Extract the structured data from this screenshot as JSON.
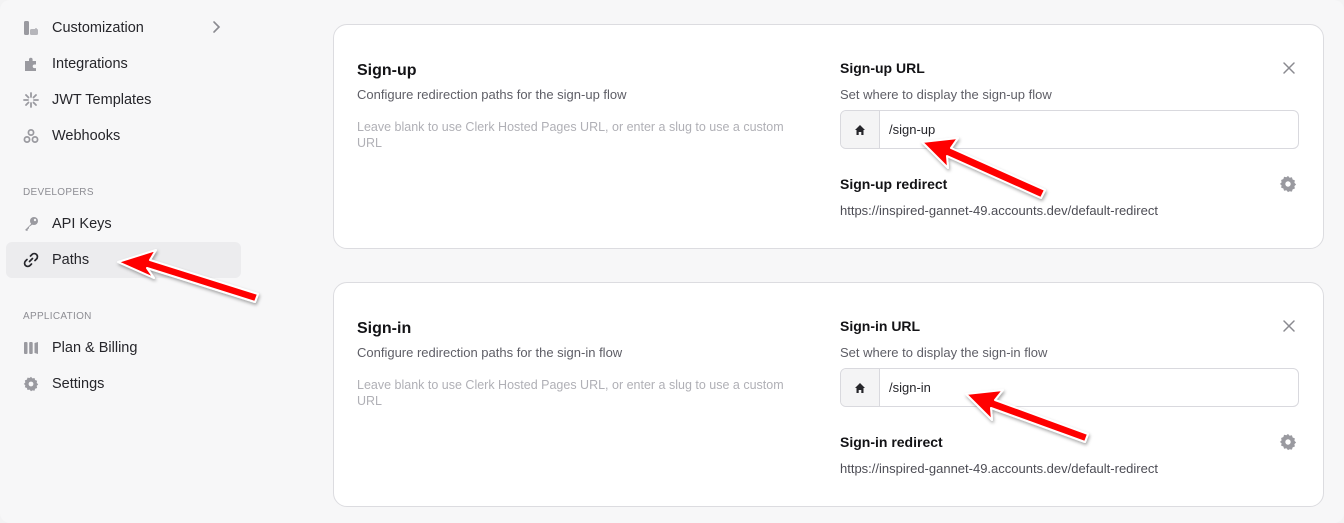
{
  "sidebar": {
    "items_top": [
      {
        "label": "Customization",
        "icon": "customization-icon"
      },
      {
        "label": "Integrations",
        "icon": "puzzle-icon"
      },
      {
        "label": "JWT Templates",
        "icon": "jwt-icon"
      },
      {
        "label": "Webhooks",
        "icon": "webhooks-icon"
      }
    ],
    "developers_label": "DEVELOPERS",
    "developers_items": [
      {
        "label": "API Keys",
        "icon": "key-icon"
      },
      {
        "label": "Paths",
        "icon": "link-icon"
      }
    ],
    "application_label": "APPLICATION",
    "application_items": [
      {
        "label": "Plan & Billing",
        "icon": "billing-icon"
      },
      {
        "label": "Settings",
        "icon": "gear-icon"
      }
    ]
  },
  "signup": {
    "title": "Sign-up",
    "description": "Configure redirection paths for the sign-up flow",
    "hint": "Leave blank to use Clerk Hosted Pages URL, or enter a slug to use a custom URL",
    "url_title": "Sign-up URL",
    "url_desc": "Set where to display the sign-up flow",
    "url_value": "/sign-up",
    "redirect_title": "Sign-up redirect",
    "redirect_url": "https://inspired-gannet-49.accounts.dev/default-redirect"
  },
  "signin": {
    "title": "Sign-in",
    "description": "Configure redirection paths for the sign-in flow",
    "hint": "Leave blank to use Clerk Hosted Pages URL, or enter a slug to use a custom URL",
    "url_title": "Sign-in URL",
    "url_desc": "Set where to display the sign-in flow",
    "url_value": "/sign-in",
    "redirect_title": "Sign-in redirect",
    "redirect_url": "https://inspired-gannet-49.accounts.dev/default-redirect"
  },
  "colors": {
    "annotation_arrow": "#ff0000",
    "active_nav_bg": "#ececee",
    "icon_gray": "#8a8a90"
  }
}
